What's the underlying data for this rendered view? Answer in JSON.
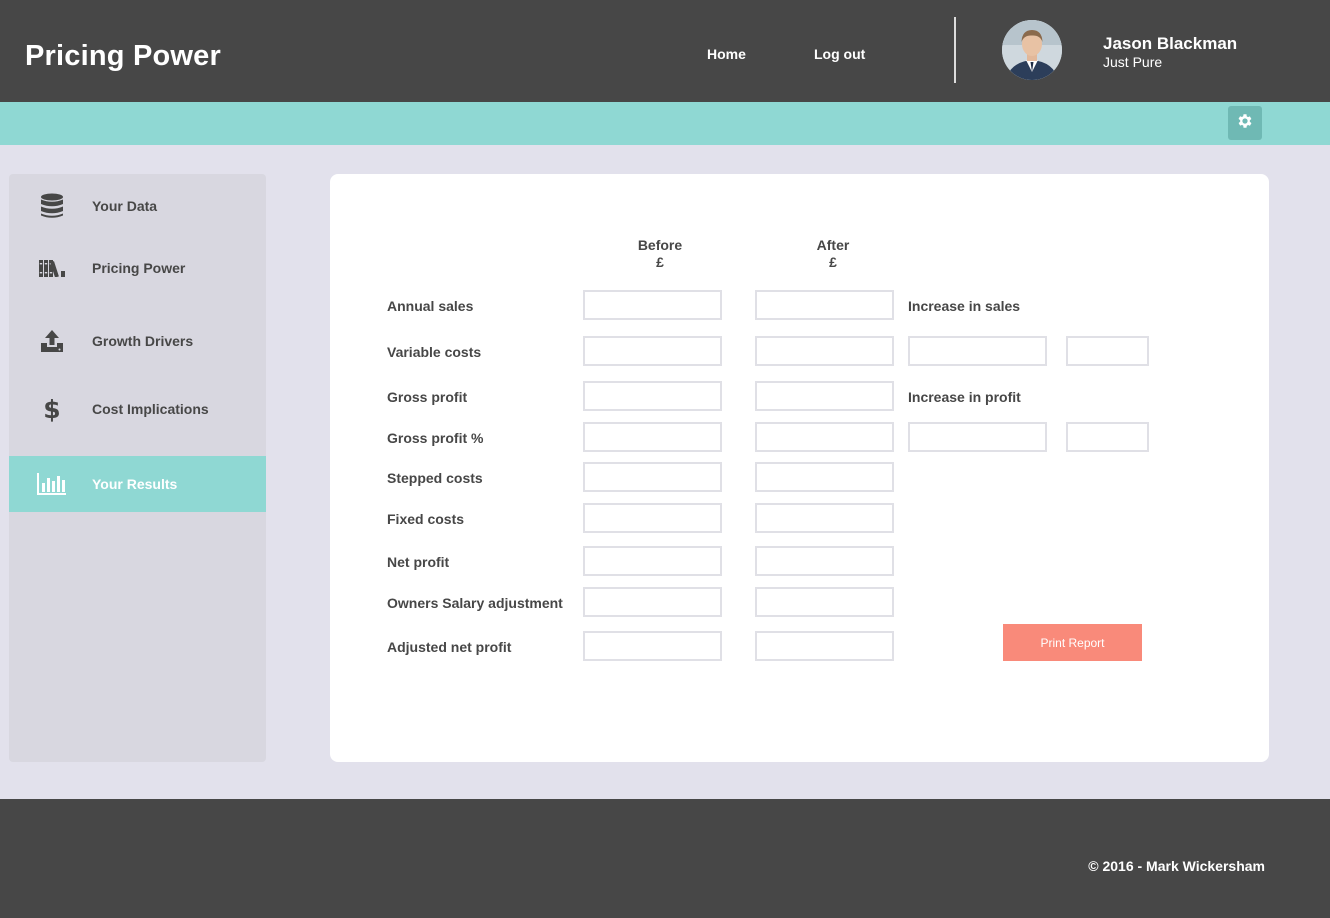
{
  "header": {
    "app_title": "Pricing Power",
    "nav": {
      "home": "Home",
      "logout": "Log out"
    },
    "user": {
      "name": "Jason Blackman",
      "company": "Just Pure",
      "avatar_icon": "user-avatar-photo"
    }
  },
  "toolbar": {
    "settings_icon": "gear-icon"
  },
  "sidebar": {
    "items": [
      {
        "label": "Your Data",
        "icon": "database-icon",
        "active": false
      },
      {
        "label": "Pricing Power",
        "icon": "books-icon",
        "active": false
      },
      {
        "label": "Growth Drivers",
        "icon": "upload-icon",
        "active": false
      },
      {
        "label": "Cost Implications",
        "icon": "dollar-icon",
        "active": false
      },
      {
        "label": "Your Results",
        "icon": "bar-chart-icon",
        "active": true
      }
    ]
  },
  "results": {
    "columns": {
      "before": {
        "label": "Before",
        "unit": "£"
      },
      "after": {
        "label": "After",
        "unit": "£"
      }
    },
    "rows": [
      {
        "label": "Annual sales",
        "before": "",
        "after": ""
      },
      {
        "label": "Variable costs",
        "before": "",
        "after": ""
      },
      {
        "label": "Gross profit",
        "before": "",
        "after": ""
      },
      {
        "label": "Gross profit %",
        "before": "",
        "after": ""
      },
      {
        "label": "Stepped costs",
        "before": "",
        "after": ""
      },
      {
        "label": "Fixed costs",
        "before": "",
        "after": ""
      },
      {
        "label": "Net profit",
        "before": "",
        "after": ""
      },
      {
        "label": "Owners Salary adjustment",
        "before": "",
        "after": ""
      },
      {
        "label": "Adjusted net profit",
        "before": "",
        "after": ""
      }
    ],
    "increase_in_sales": {
      "label": "Increase in sales",
      "amount": "",
      "percent": ""
    },
    "increase_in_profit": {
      "label": "Increase in profit",
      "amount": "",
      "percent": ""
    },
    "print_button": "Print Report"
  },
  "footer": {
    "copyright": "© 2016 - Mark Wickersham"
  },
  "colors": {
    "header": "#474747",
    "accent_teal": "#8fd8d3",
    "print_button": "#f98a7a",
    "background": "#e2e1ec"
  }
}
